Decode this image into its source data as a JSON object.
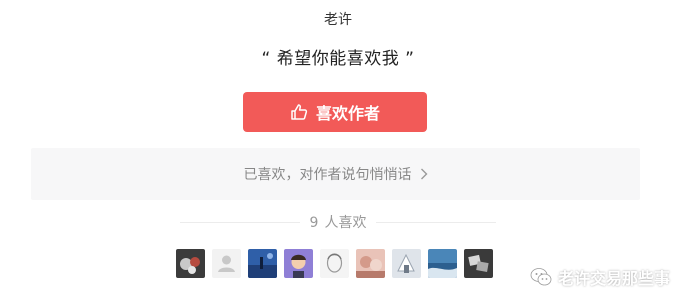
{
  "author": {
    "name": "老许"
  },
  "quote": {
    "text": "“ 希望你能喜欢我 ”"
  },
  "like_button": {
    "label": "喜欢作者",
    "icon": "thumbs-up-icon",
    "color": "#f25a58"
  },
  "message_box": {
    "text": "已喜欢，对作者说句悄悄话",
    "icon": "chevron-right-icon"
  },
  "likes": {
    "count": "9",
    "label": "人喜欢"
  },
  "avatars": [
    {
      "name": "avatar-1"
    },
    {
      "name": "avatar-2"
    },
    {
      "name": "avatar-3"
    },
    {
      "name": "avatar-4"
    },
    {
      "name": "avatar-5"
    },
    {
      "name": "avatar-6"
    },
    {
      "name": "avatar-7"
    },
    {
      "name": "avatar-8"
    },
    {
      "name": "avatar-9"
    }
  ],
  "watermark": {
    "text": "老许交易那些事",
    "icon": "wechat-icon"
  }
}
